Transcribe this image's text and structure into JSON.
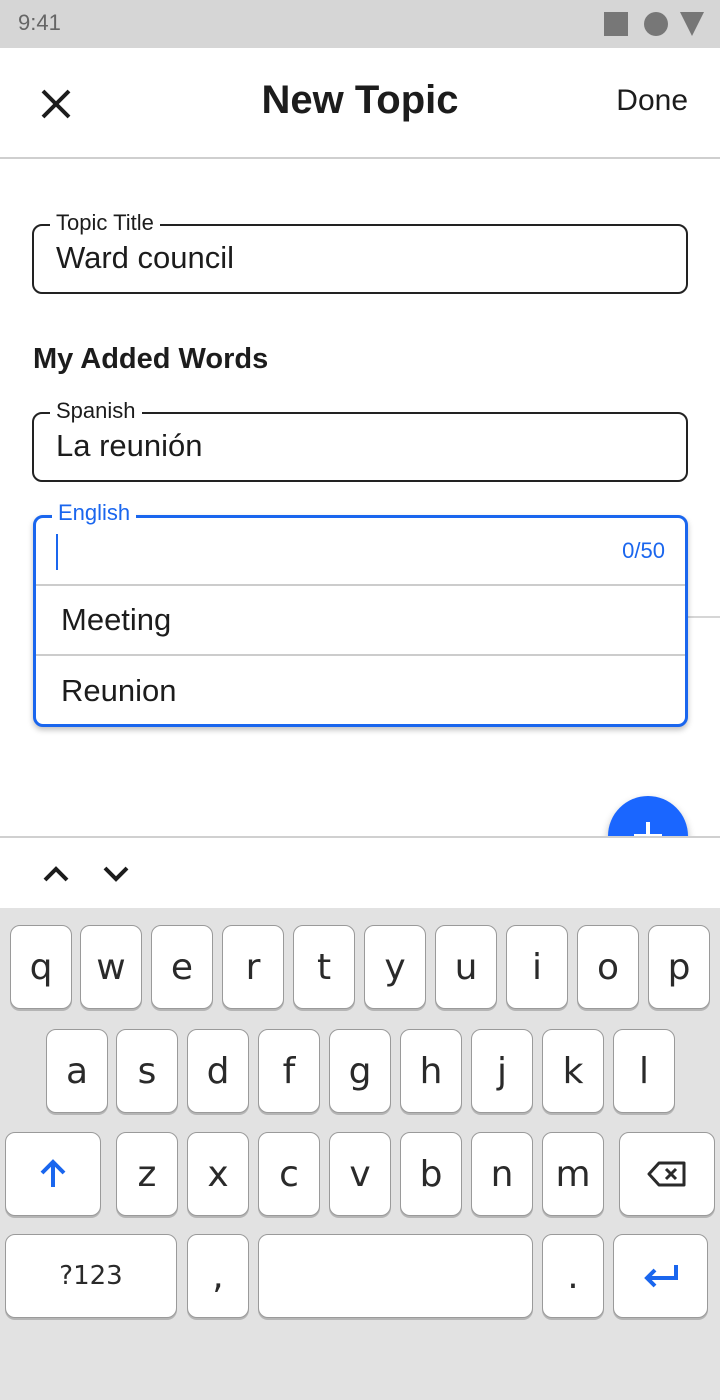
{
  "status_bar": {
    "time": "9:41"
  },
  "app_bar": {
    "title": "New Topic",
    "done_label": "Done"
  },
  "topic_title": {
    "label": "Topic Title",
    "value": "Ward council"
  },
  "section": {
    "heading": "My Added Words"
  },
  "spanish": {
    "label": "Spanish",
    "value": "La reunión"
  },
  "english": {
    "label": "English",
    "value": "",
    "counter": "0/50",
    "suggestions": [
      "Meeting",
      "Reunion"
    ]
  },
  "keyboard": {
    "row1": [
      "q",
      "w",
      "e",
      "r",
      "t",
      "y",
      "u",
      "i",
      "o",
      "p"
    ],
    "row2": [
      "a",
      "s",
      "d",
      "f",
      "g",
      "h",
      "j",
      "k",
      "l"
    ],
    "row3": [
      "z",
      "x",
      "c",
      "v",
      "b",
      "n",
      "m"
    ],
    "symbols_label": "?123",
    "comma": ",",
    "period": "."
  },
  "colors": {
    "accent": "#1a66ee",
    "fab": "#1a66ff"
  },
  "icons": [
    "close-icon",
    "plus-icon",
    "chevron-up-icon",
    "chevron-down-icon",
    "shift-icon",
    "backspace-icon",
    "enter-icon"
  ]
}
